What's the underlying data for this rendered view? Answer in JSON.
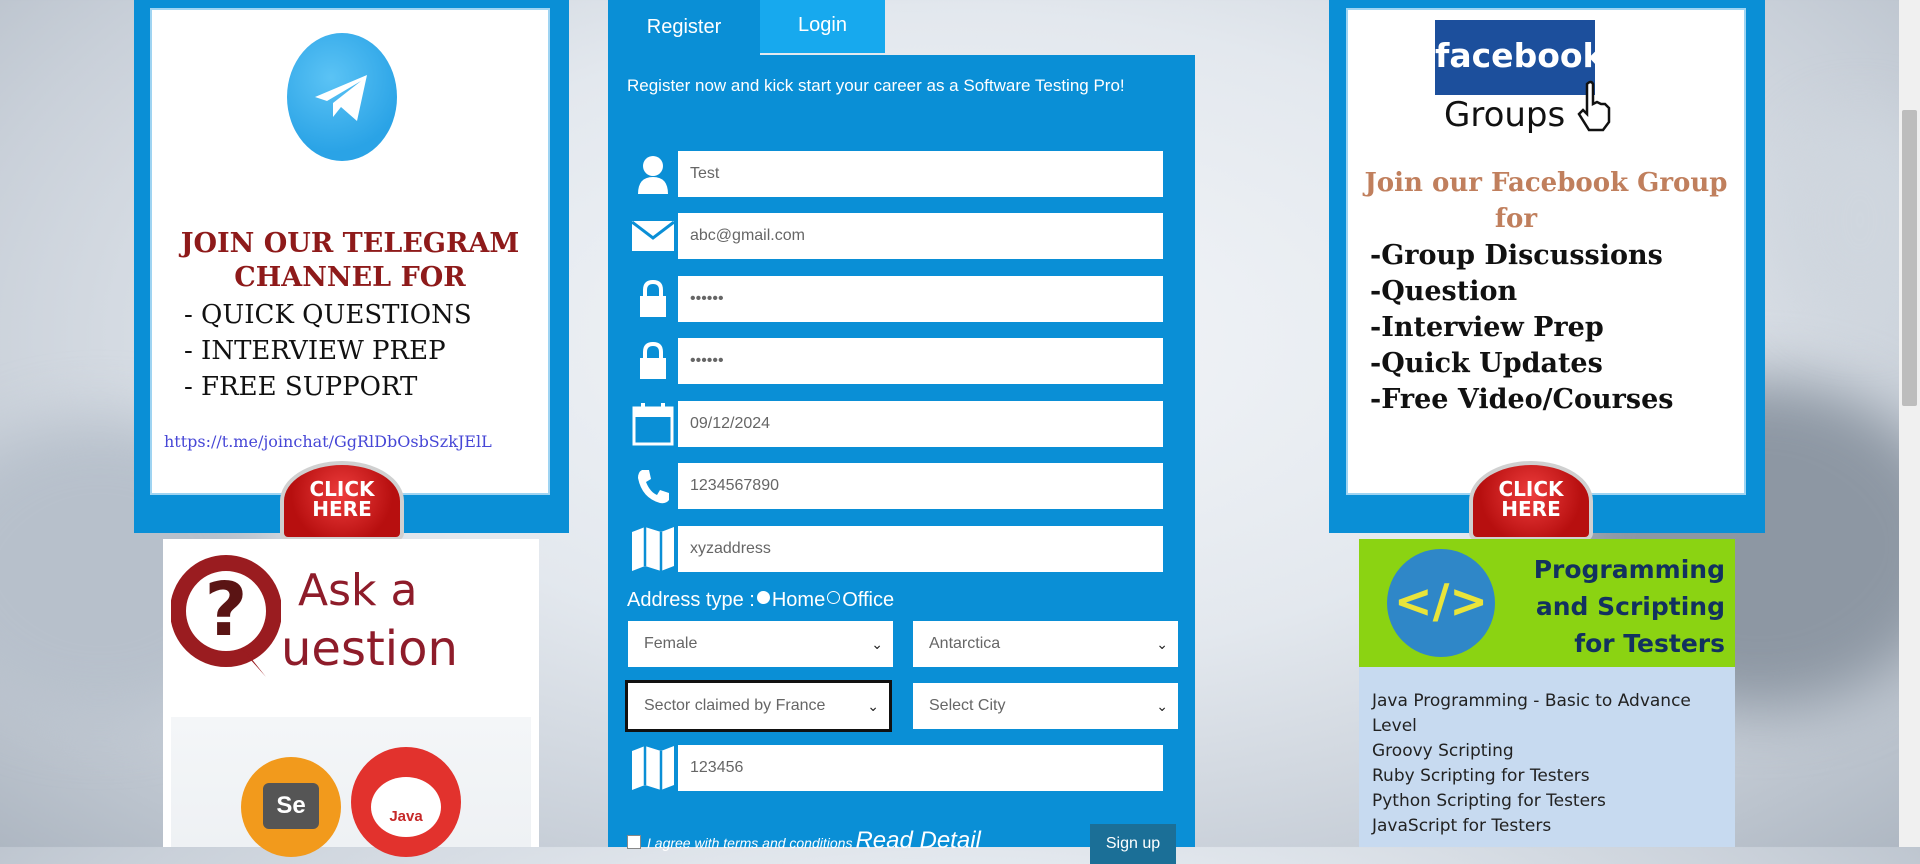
{
  "telegram_card": {
    "title_line1": "JOIN OUR TELEGRAM",
    "title_line2": "CHANNEL  FOR",
    "items": [
      "- QUICK QUESTIONS",
      "- INTERVIEW PREP",
      "- FREE SUPPORT"
    ],
    "link": "https://t.me/joinchat/GgRlDbOsbSzkJElL",
    "click_here_line1": "CLICK",
    "click_here_line2": "HERE"
  },
  "ask_card": {
    "line1": "Ask a",
    "line2": "uestion",
    "gear_left": "Se",
    "gear_right": "Java"
  },
  "tabs": {
    "register": "Register",
    "login": "Login"
  },
  "form": {
    "intro": "Register now and kick start your career as a Software Testing Pro!",
    "fields": {
      "name": "Test",
      "email": "abc@gmail.com",
      "password": "••••••",
      "confirm_password": "••••••",
      "dob": "09/12/2024",
      "phone": "1234567890",
      "address": "xyzaddress",
      "zip": "123456"
    },
    "address_type_label": "Address type :",
    "address_type_options": [
      "Home",
      "Office"
    ],
    "address_type_selected": "Home",
    "gender": "Female",
    "country": "Antarctica",
    "state": "Sector claimed by France",
    "city": "Select City",
    "terms_text": "I agree with terms and conditions",
    "read_detail": "Read Detail",
    "signup": "Sign up"
  },
  "facebook_card": {
    "logo": "facebook",
    "groups": "Groups",
    "title_line1": "Join our Facebook Group",
    "title_line2": "for",
    "items": [
      "-Group Discussions",
      "-Question",
      "-Interview Prep",
      "-Quick Updates",
      "-Free Video/Courses"
    ],
    "click_here_line1": "CLICK",
    "click_here_line2": "HERE"
  },
  "programming_card": {
    "title_line1": "Programming",
    "title_line2": "and Scripting",
    "title_line3": "for Testers",
    "items": [
      "Java Programming - Basic to Advance Level",
      "Groovy Scripting",
      "Ruby Scripting for Testers",
      "Python Scripting for Testers",
      "JavaScript for Testers"
    ]
  },
  "colors": {
    "form_blue": "#0a8fd6",
    "login_tab": "#17a9ee",
    "signup": "#1b6f97"
  }
}
